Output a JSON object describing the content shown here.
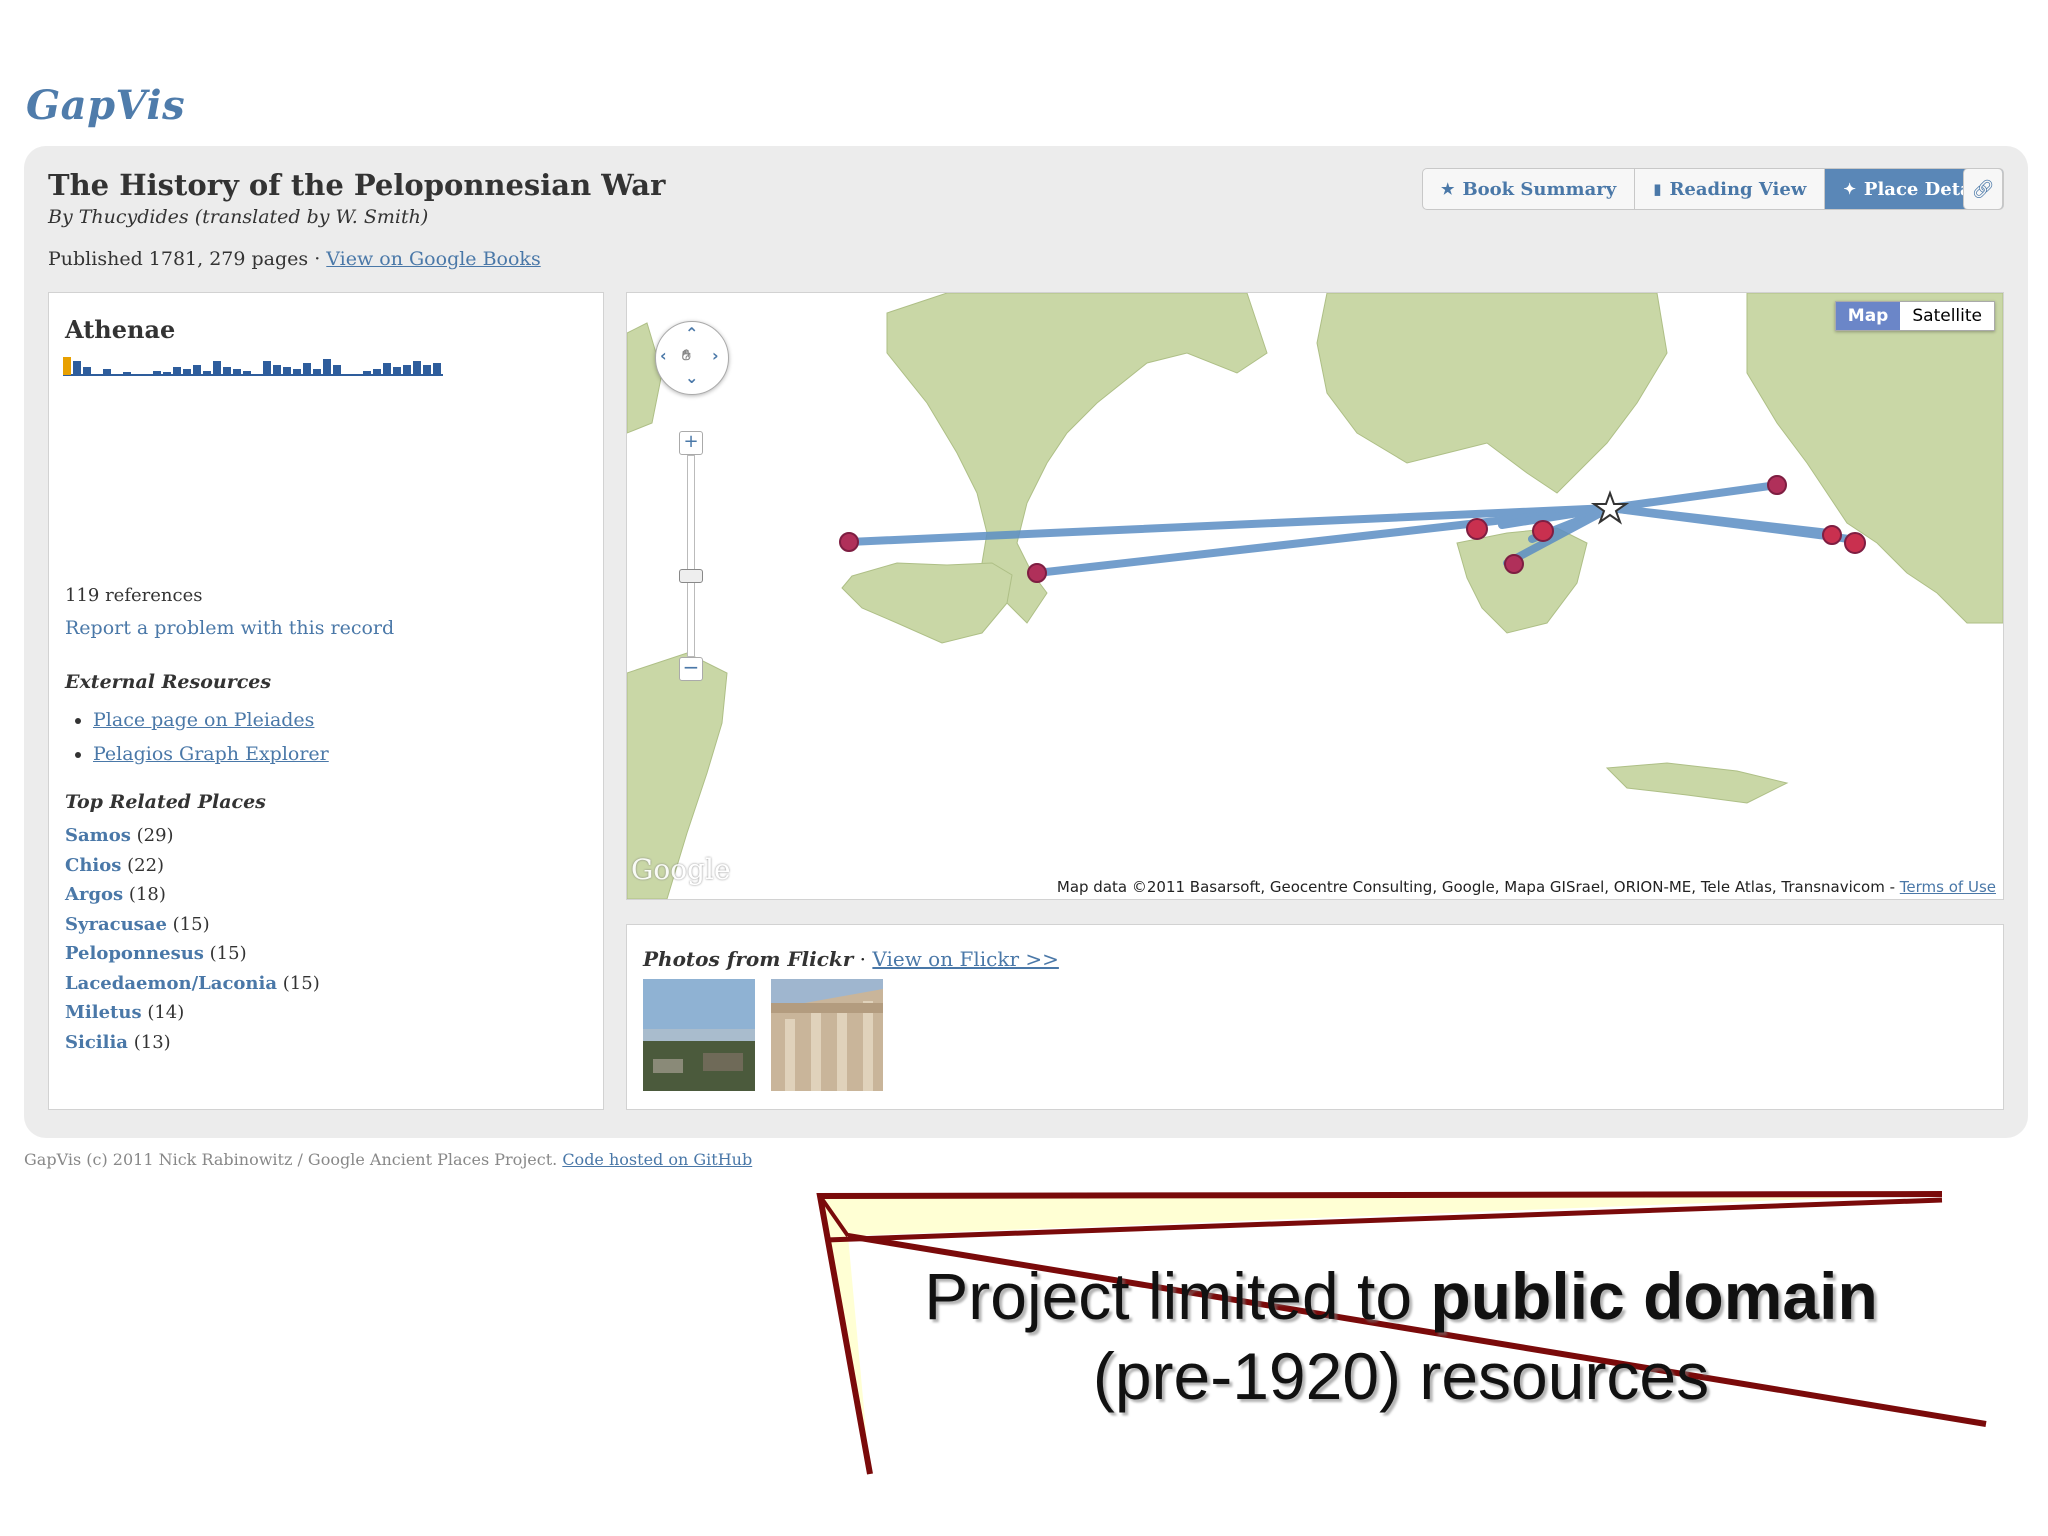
{
  "app": {
    "logo": "GapVis"
  },
  "book": {
    "title": "The History of the Peloponnesian War",
    "author": "By Thucydides (translated by W. Smith)",
    "published_prefix": "Published 1781, 279 pages · ",
    "google_books_link": "View on Google Books"
  },
  "tabs": [
    {
      "label": "Book Summary",
      "icon": "star-icon",
      "active": false
    },
    {
      "label": "Reading View",
      "icon": "book-icon",
      "active": false
    },
    {
      "label": "Place Detail",
      "icon": "pin-icon",
      "active": true
    }
  ],
  "link_button": {
    "icon": "link-icon"
  },
  "place": {
    "name": "Athenae",
    "references": "119 references",
    "report_link": "Report a problem with this record",
    "frequency": [
      0.9,
      0.7,
      0.4,
      0,
      0.3,
      0,
      0.15,
      0,
      0,
      0.2,
      0.15,
      0.4,
      0.3,
      0.5,
      0.2,
      0.7,
      0.4,
      0.3,
      0.2,
      0,
      0.7,
      0.5,
      0.4,
      0.3,
      0.6,
      0.3,
      0.8,
      0.5,
      0,
      0,
      0.2,
      0.3,
      0.6,
      0.4,
      0.5,
      0.7,
      0.5,
      0.6
    ],
    "frequency_highlight_index": 0
  },
  "external": {
    "heading": "External Resources",
    "links": [
      "Place page on Pleiades",
      "Pelagios Graph Explorer"
    ]
  },
  "related": {
    "heading": "Top Related Places",
    "places": [
      {
        "name": "Samos",
        "count": "(29)"
      },
      {
        "name": "Chios",
        "count": "(22)"
      },
      {
        "name": "Argos",
        "count": "(18)"
      },
      {
        "name": "Syracusae",
        "count": "(15)"
      },
      {
        "name": "Peloponnesus",
        "count": "(15)"
      },
      {
        "name": "Lacedaemon/Laconia",
        "count": "(15)"
      },
      {
        "name": "Miletus",
        "count": "(14)"
      },
      {
        "name": "Sicilia",
        "count": "(13)"
      }
    ]
  },
  "map": {
    "type_buttons": [
      "Map",
      "Satellite"
    ],
    "active_type": "Map",
    "logo": "Google",
    "attribution": "Map data ©2011 Basarsoft, Geocentre Consulting, Google, Mapa GISrael, ORION-ME, Tele Atlas, Transnavicom - ",
    "terms_link": "Terms of Use",
    "line_color": "#5b8ec4",
    "marker_color": "#b0305a"
  },
  "photos": {
    "heading": "Photos from Flickr",
    "separator": " · ",
    "link": "View on Flickr >>"
  },
  "footer": {
    "text": "GapVis (c) 2011 Nick Rabinowitz / Google Ancient Places Project. ",
    "link": "Code hosted on GitHub"
  },
  "callout": {
    "line1_plain": "Project limited to ",
    "line1_bold": "public domain",
    "line2": "(pre-1920) resources"
  }
}
